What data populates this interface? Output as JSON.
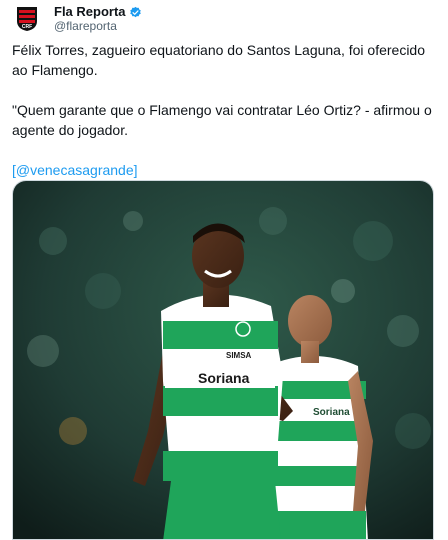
{
  "account": {
    "display_name": "Fla Reporta",
    "handle": "@flareporta",
    "avatar_icon": "flamengo-crest-icon",
    "verified_icon": "verified-badge-icon",
    "verified_color": "#1d9bf0"
  },
  "tweet": {
    "paragraph1": "Félix Torres, zagueiro equatoriano do Santos Laguna, foi oferecido ao Flamengo.",
    "paragraph2": "\"Quem garante que o Flamengo vai contratar Léo Ortiz? - afirmou o agente do jogador.",
    "mention_open": "[",
    "mention": "@venecasagrande",
    "mention_close": "]"
  },
  "media": {
    "jersey_sponsor": "Soriana",
    "jersey_sponsor_2": "SIMSA",
    "jersey_colors": [
      "#1fa55a",
      "#ffffff"
    ]
  },
  "colors": {
    "link": "#1d9bf0",
    "text": "#0f1419",
    "secondary": "#536471"
  }
}
